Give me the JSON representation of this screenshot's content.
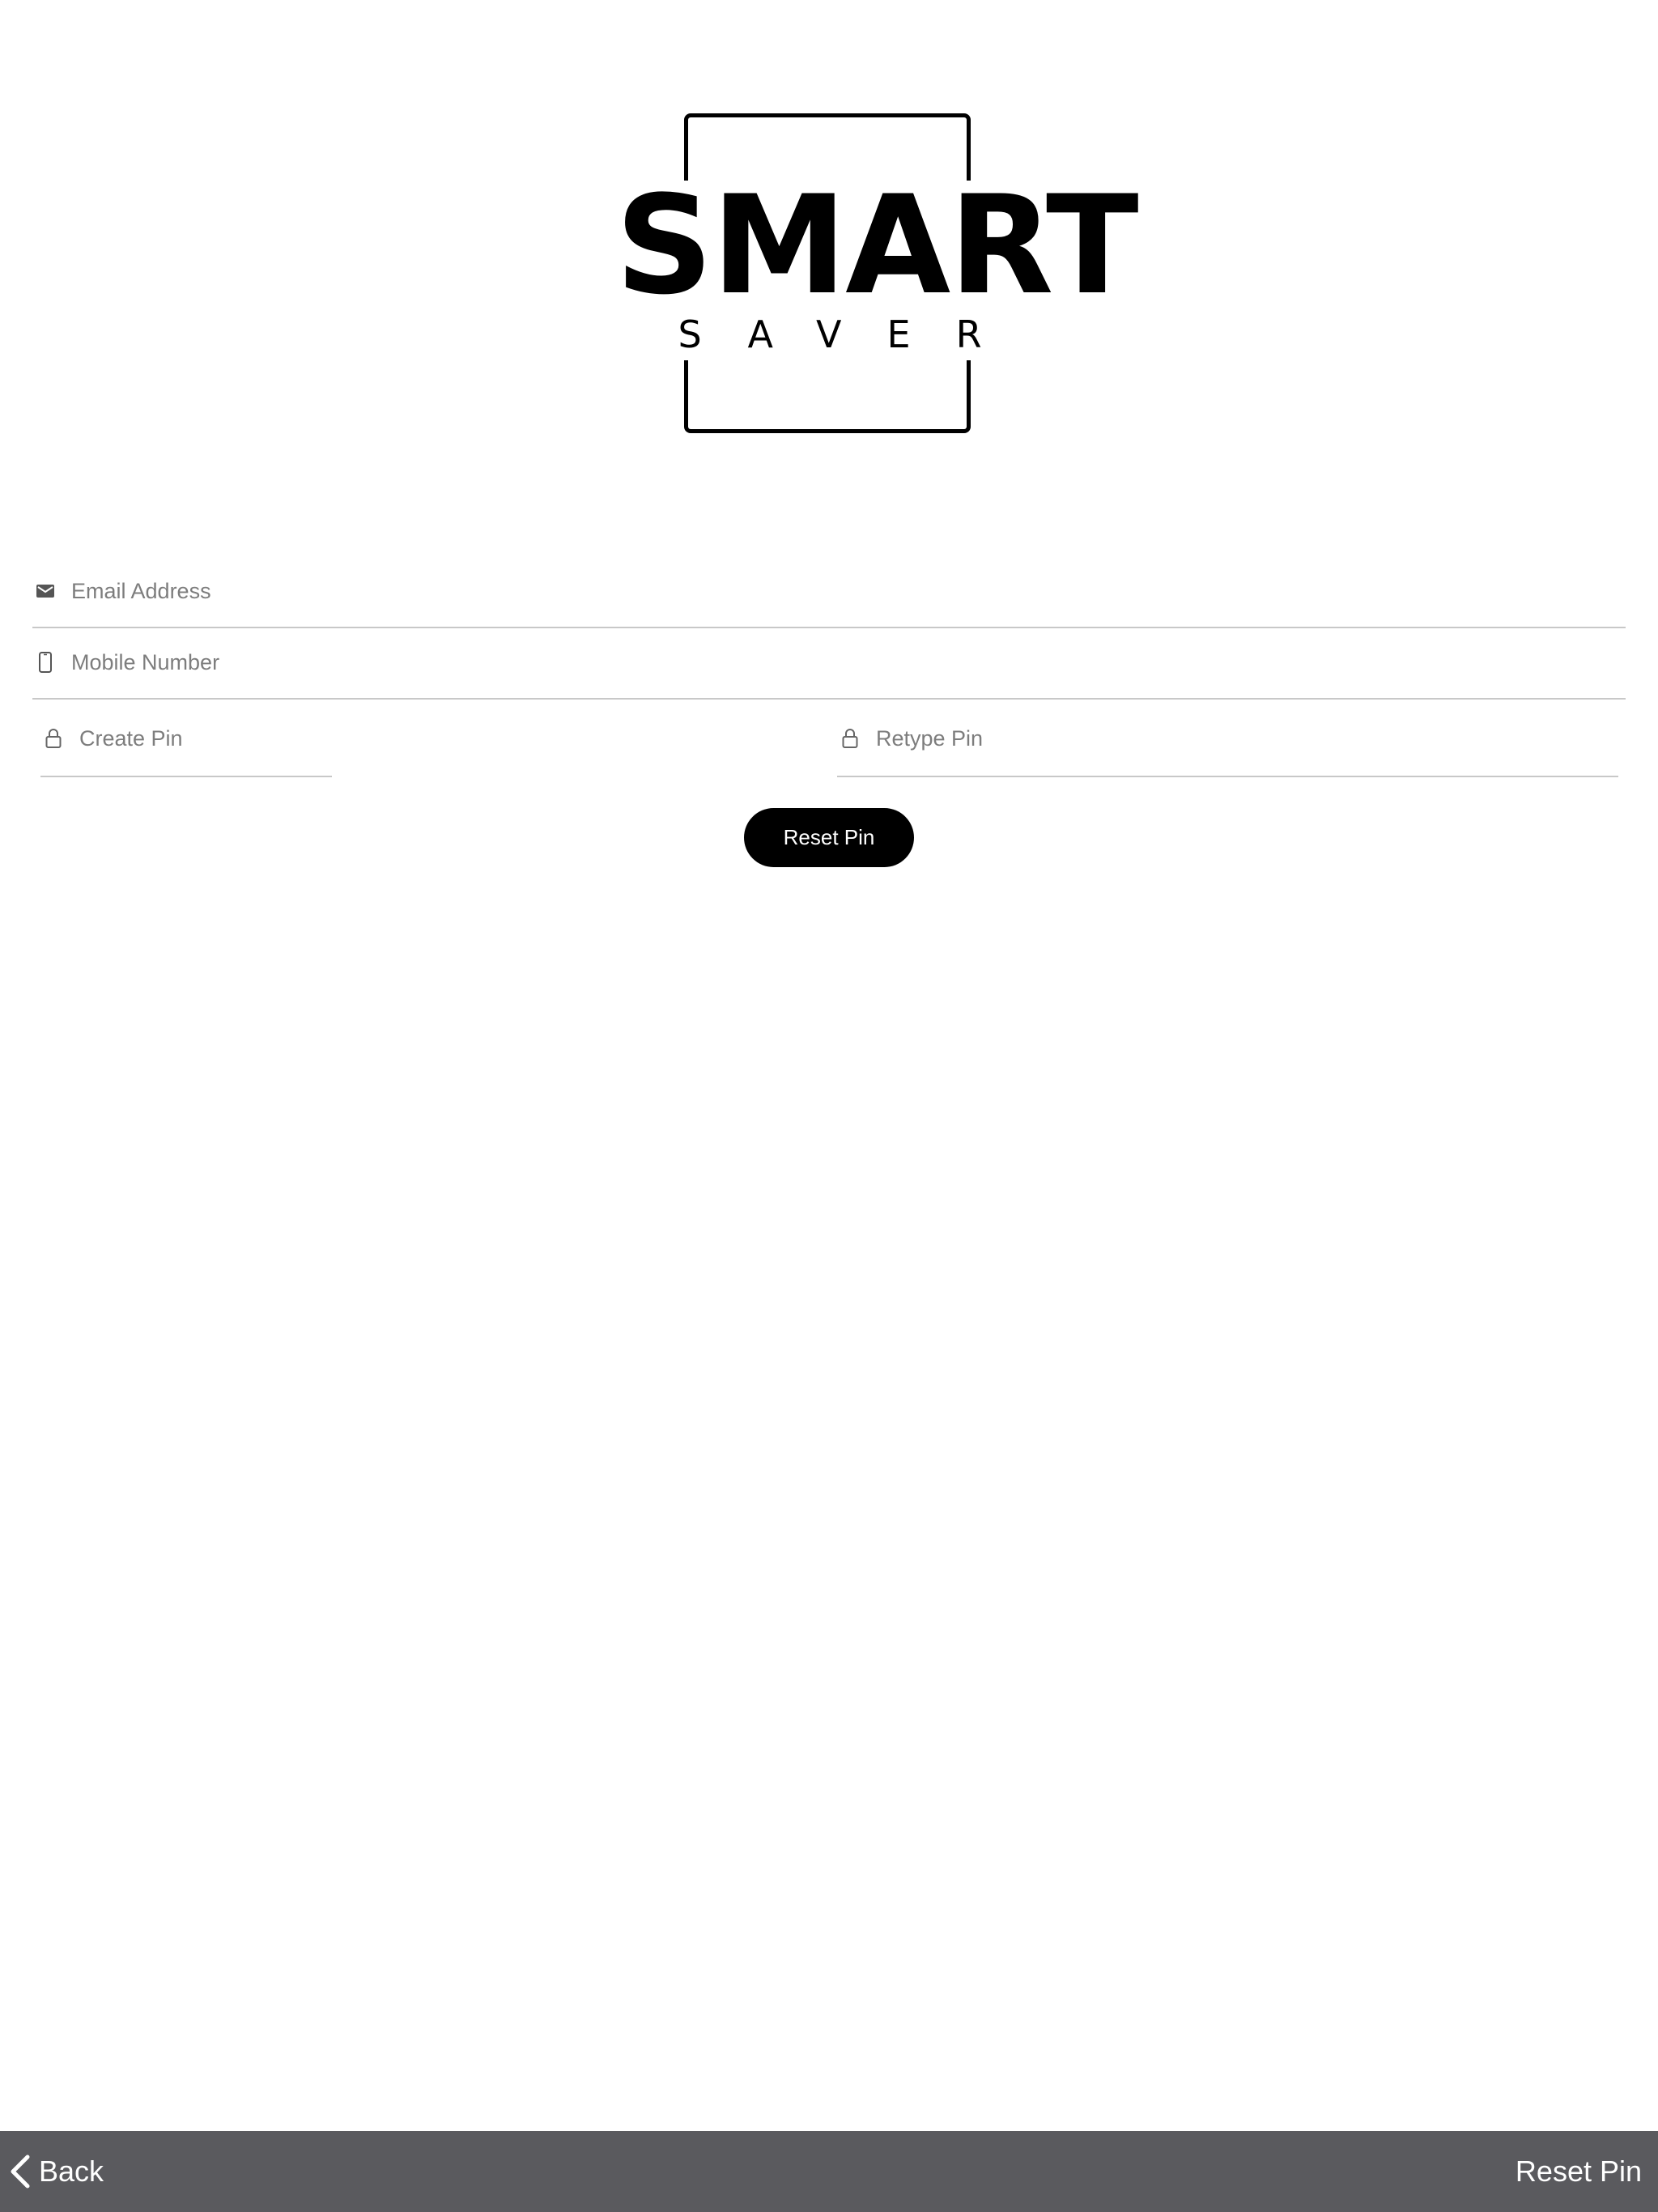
{
  "logo": {
    "line1": "SMART",
    "line2": "SAVER"
  },
  "form": {
    "email": {
      "placeholder": "Email Address",
      "value": "",
      "icon": "mail-icon"
    },
    "mobile": {
      "placeholder": "Mobile Number",
      "value": "",
      "icon": "phone-icon"
    },
    "create_pin": {
      "placeholder": "Create Pin",
      "value": "",
      "icon": "lock-icon"
    },
    "retype_pin": {
      "placeholder": "Retype Pin",
      "value": "",
      "icon": "lock-icon"
    },
    "submit_label": "Reset Pin"
  },
  "bottom_bar": {
    "back_label": "Back",
    "back_icon": "chevron-left-icon",
    "title": "Reset Pin"
  },
  "colors": {
    "background": "#ffffff",
    "primary_button": "#000000",
    "bottom_bar": "#5a5a5e",
    "placeholder": "#7d7d7d",
    "divider": "#c8c8c8"
  }
}
